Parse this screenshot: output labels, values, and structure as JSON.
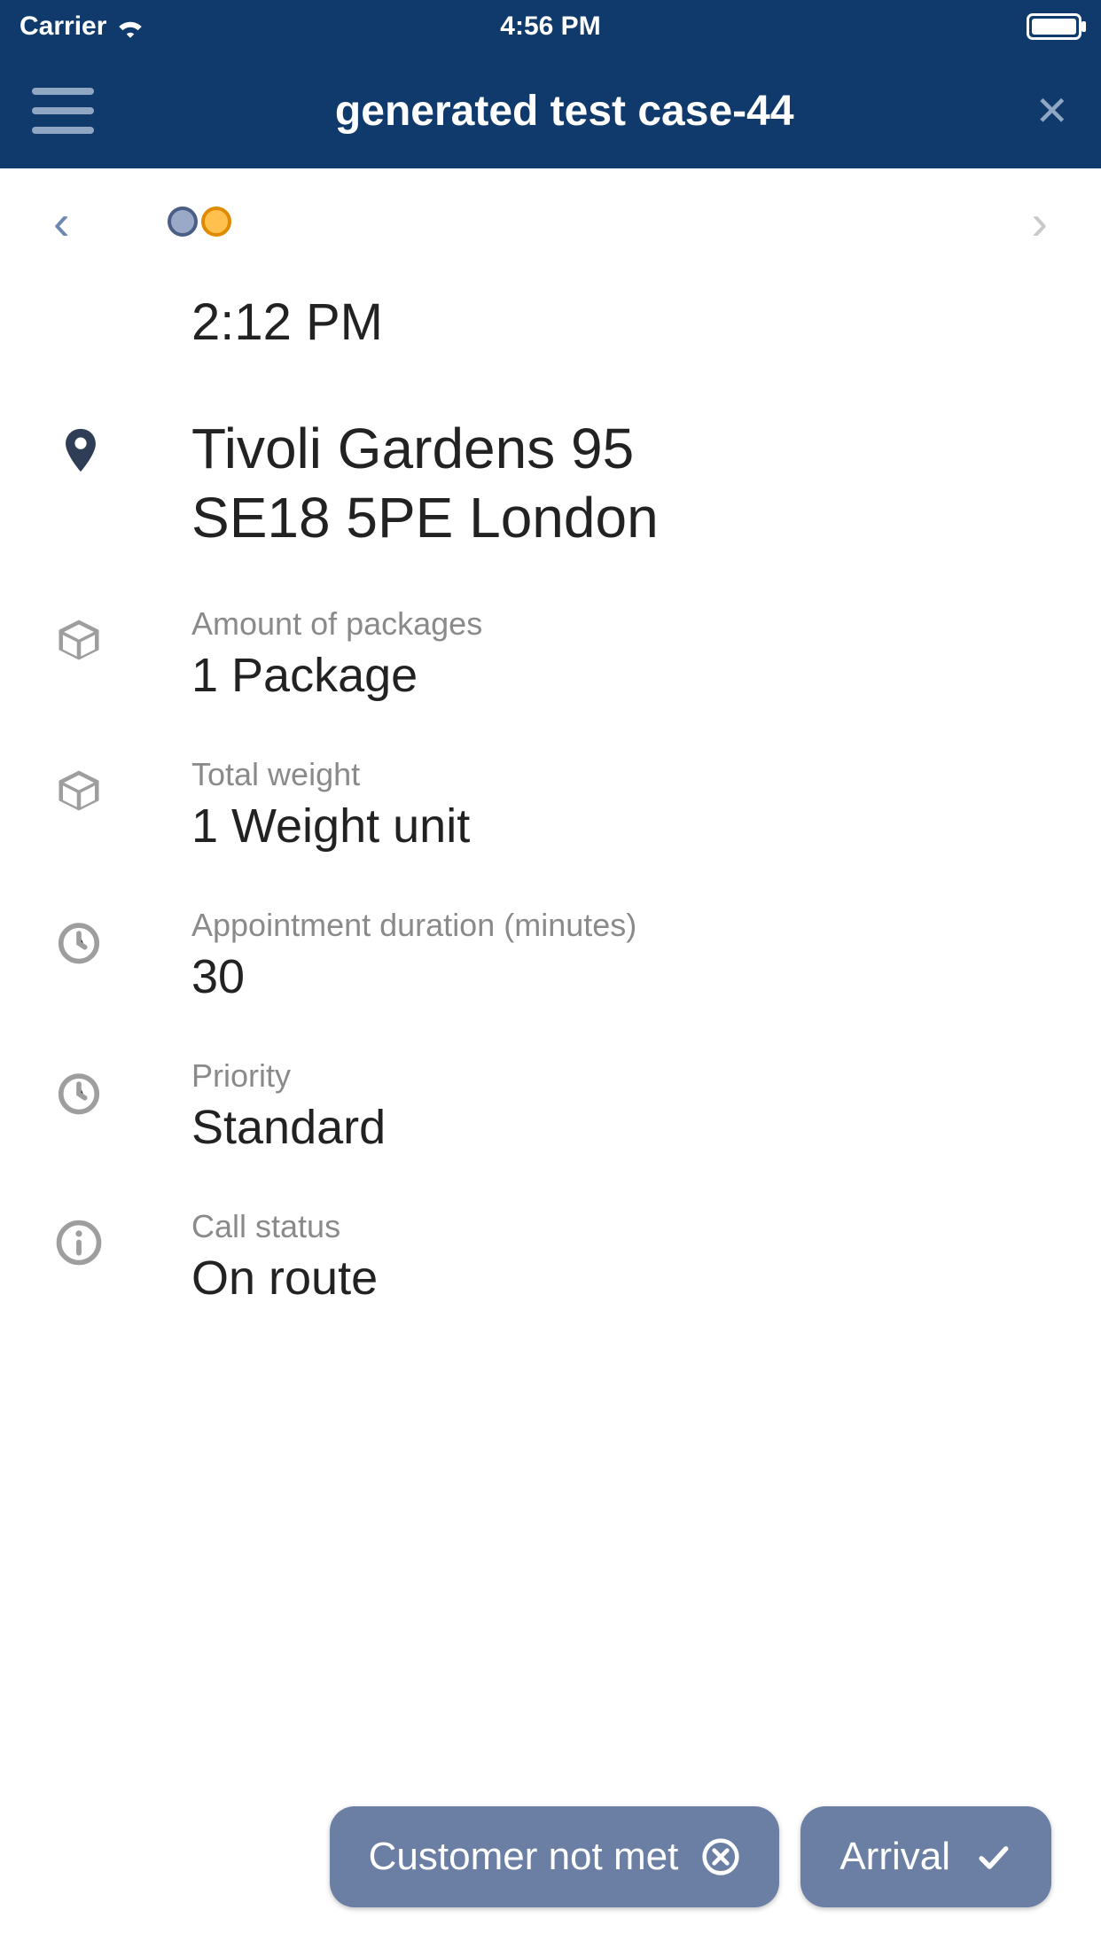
{
  "status_bar": {
    "carrier": "Carrier",
    "time": "4:56 PM"
  },
  "nav": {
    "title": "generated test case-44"
  },
  "detail": {
    "time": "2:12 PM",
    "address_line1": "Tivoli Gardens 95",
    "address_line2": "SE18 5PE London",
    "packages_label": "Amount of packages",
    "packages_value": "1 Package",
    "weight_label": "Total weight",
    "weight_value": "1 Weight unit",
    "duration_label": "Appointment duration (minutes)",
    "duration_value": "30",
    "priority_label": "Priority",
    "priority_value": "Standard",
    "callstatus_label": "Call status",
    "callstatus_value": "On route"
  },
  "buttons": {
    "not_met": "Customer not met",
    "arrival": "Arrival"
  }
}
